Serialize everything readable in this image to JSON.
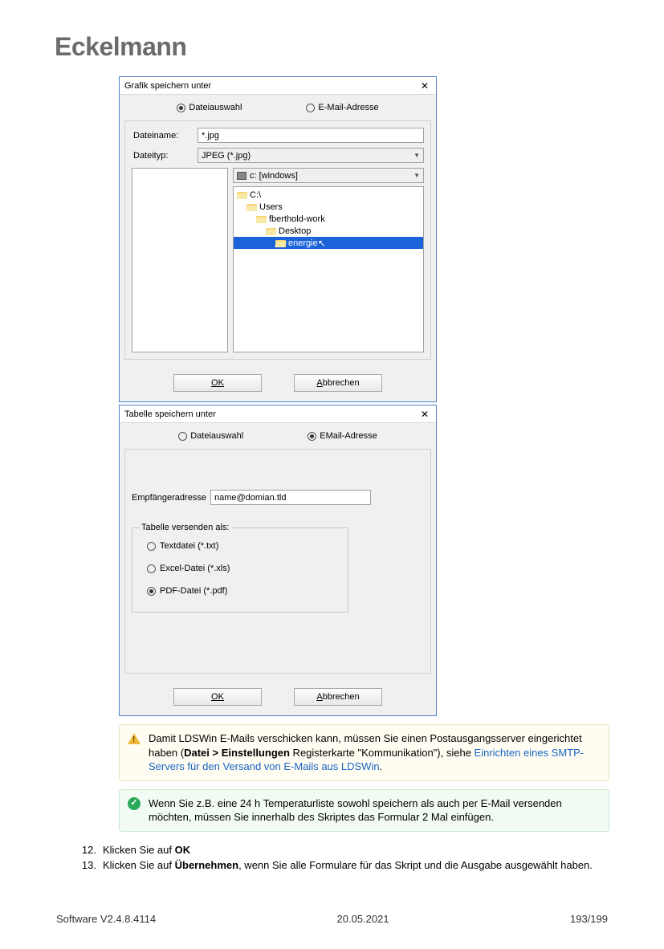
{
  "header": {
    "brand": "Eckelmann"
  },
  "dialog1": {
    "title": "Grafik speichern unter",
    "close": "✕",
    "radio_file": "Dateiauswahl",
    "radio_mail": "E-Mail-Adresse",
    "filename_label": "Dateiname:",
    "filename_value": "*.jpg",
    "filetype_label": "Dateityp:",
    "filetype_value": "JPEG (*.jpg)",
    "drive_value": "c: [windows]",
    "tree": {
      "n0": "C:\\",
      "n1": "Users",
      "n2": "fberthold-work",
      "n3": "Desktop",
      "n4": "energie"
    },
    "ok": "OK",
    "cancel_pre": "A",
    "cancel_rest": "bbrechen"
  },
  "dialog2": {
    "title": "Tabelle speichern unter",
    "close": "✕",
    "radio_file": "Dateiauswahl",
    "radio_mail": "EMail-Adresse",
    "addr_label": "Empfängeradresse",
    "addr_value": "name@domian.tld",
    "fieldset_legend": "Tabelle versenden als:",
    "opt_txt": "Textdatei (*.txt)",
    "opt_xls": "Excel-Datei (*.xls)",
    "opt_pdf": "PDF-Datei (*.pdf)",
    "ok": "OK",
    "cancel_pre": "A",
    "cancel_rest": "bbrechen"
  },
  "notes": {
    "warn_t1": "Damit LDSWin E-Mails verschicken kann, müssen Sie einen Postausgangsserver eingerichtet haben (",
    "warn_bold": "Datei > Einstellungen",
    "warn_t2": " Registerkarte \"Kommunikation\"), siehe ",
    "warn_link": "Einrichten eines SMTP-Servers für den Versand von E-Mails aus LDSWin",
    "warn_t3": ".",
    "ok_text": "Wenn Sie z.B. eine 24 h Temperaturliste sowohl speichern als auch per E-Mail versenden möchten, müssen Sie innerhalb des Skriptes das Formular 2 Mal einfügen."
  },
  "steps": {
    "n12": "12.",
    "t12a": "Klicken Sie auf ",
    "t12b": "OK",
    "n13": "13.",
    "t13a": "Klicken Sie auf ",
    "t13b": "Übernehmen",
    "t13c": ", wenn Sie alle Formulare für das Skript und die Ausgabe ausgewählt haben."
  },
  "footer": {
    "left": "Software V2.4.8.4114",
    "center": "20.05.2021",
    "right": "193/199"
  }
}
